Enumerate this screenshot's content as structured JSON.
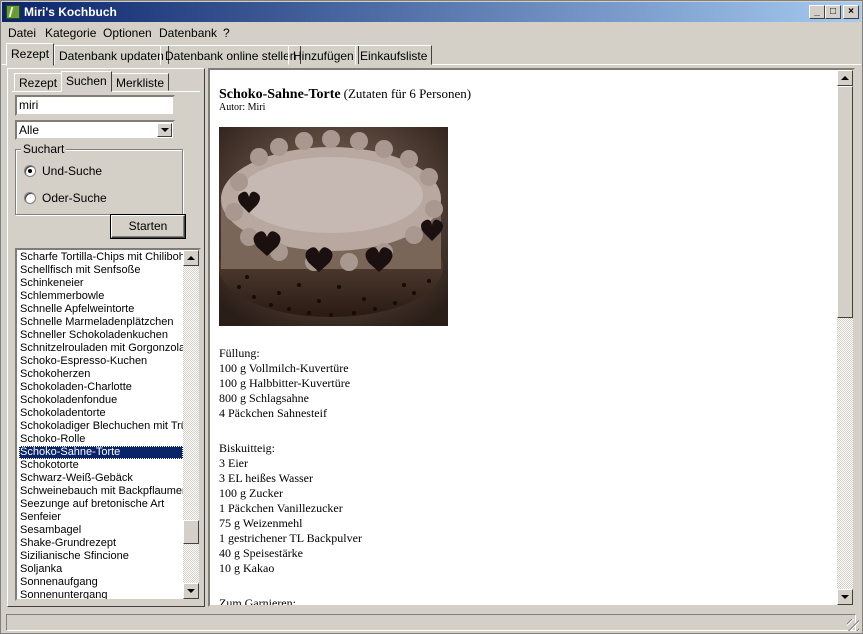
{
  "window": {
    "title": "Miri's Kochbuch"
  },
  "menu": [
    "Datei",
    "Kategorie",
    "Optionen",
    "Datenbank",
    "?"
  ],
  "top_tabs": [
    "Rezept",
    "Datenbank updaten",
    "Datenbank online stellen",
    "Hinzufügen",
    "Einkaufsliste"
  ],
  "sidebar": {
    "tabs": [
      "Rezept",
      "Suchen",
      "Merkliste"
    ],
    "search_value": "miri",
    "category_select": "Alle",
    "search_mode_label": "Suchart",
    "radio_and": "Und-Suche",
    "radio_or": "Oder-Suche",
    "start_button": "Starten",
    "results": [
      "Scharfe Tortilla-Chips mit Chilibohnen",
      "Schellfisch mit Senfsoße",
      "Schinkeneier",
      "Schlemmerbowle",
      "Schnelle Apfelweintorte",
      "Schnelle Marmeladenplätzchen",
      "Schneller Schokoladenkuchen",
      "Schnitzelrouladen mit Gorgonzola",
      "Schoko-Espresso-Kuchen",
      "Schokoherzen",
      "Schokoladen-Charlotte",
      "Schokoladenfondue",
      "Schokoladentorte",
      "Schokoladiger Blechuchen mit Trü",
      "Schoko-Rolle",
      "Schoko-Sahne-Torte",
      "Schokotorte",
      "Schwarz-Weiß-Gebäck",
      "Schweinebauch mit Backpflaumen",
      "Seezunge auf bretonische Art",
      "Senfeier",
      "Sesambagel",
      "Shake-Grundrezept",
      "Sizilianische Sfincione",
      "Soljanka",
      "Sonnenaufgang",
      "Sonnenuntergang"
    ],
    "selected_index": 15
  },
  "recipe": {
    "title": "Schoko-Sahne-Torte",
    "servings": "(Zutaten für 6 Personen)",
    "author": "Autor: Miri",
    "sections": [
      {
        "title": "Füllung:",
        "lines": [
          "100 g Vollmilch-Kuvertüre",
          "100 g Halbbitter-Kuvertüre",
          "800 g Schlagsahne",
          "4 Päckchen Sahnesteif"
        ]
      },
      {
        "title": "Biskuitteig:",
        "lines": [
          "3 Eier",
          "3 EL heißes Wasser",
          "100 g Zucker",
          "1 Päckchen Vanillezucker",
          "75 g Weizenmehl",
          "1 gestrichener TL Backpulver",
          "40 g Speisestärke",
          "10 g Kakao"
        ]
      },
      {
        "title": "Zum Garnieren:",
        "lines": []
      }
    ]
  },
  "colors": {
    "title_bar_start": "#0a246a",
    "title_bar_end": "#a6caf0",
    "selection": "#0a246a",
    "face": "#d4d0c8"
  }
}
